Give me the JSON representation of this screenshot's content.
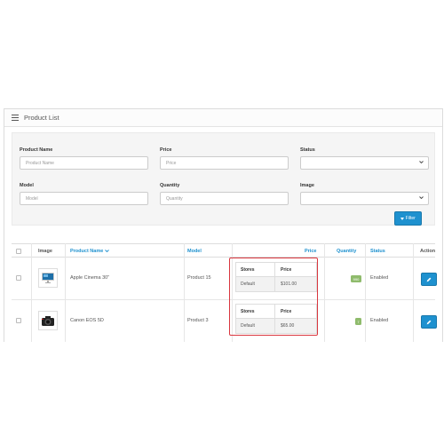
{
  "panel": {
    "title": "Product List",
    "title_icon": "list-icon"
  },
  "filter": {
    "product_name_label": "Product Name",
    "product_name_placeholder": "Product Name",
    "price_label": "Price",
    "price_placeholder": "Price",
    "status_label": "Status",
    "status_value": "",
    "model_label": "Model",
    "model_placeholder": "Model",
    "quantity_label": "Quantity",
    "quantity_placeholder": "Quantity",
    "image_label": "Image",
    "image_value": "",
    "filter_button": "Filter",
    "filter_icon": "funnel-icon"
  },
  "table": {
    "headers": {
      "image": "Image",
      "product_name": "Product Name",
      "model": "Model",
      "price": "Price",
      "quantity": "Quantity",
      "status": "Status",
      "action": "Action"
    },
    "sort_indicator": "chevron-down-icon",
    "store_header_stores": "Stores",
    "store_header_price": "Price",
    "rows": [
      {
        "image_icon": "monitor-icon",
        "product_name": "Apple Cinema 30\"",
        "model": "Product 15",
        "stores": [
          {
            "store": "Default",
            "price": "$101.00"
          }
        ],
        "quantity": "990",
        "status": "Enabled",
        "action_icon": "pencil-icon"
      },
      {
        "image_icon": "camera-icon",
        "product_name": "Canon EOS 5D",
        "model": "Product 3",
        "stores": [
          {
            "store": "Default",
            "price": "$65.00"
          }
        ],
        "quantity": "7",
        "status": "Enabled",
        "action_icon": "pencil-icon"
      }
    ]
  },
  "colors": {
    "accent": "#1e91cf",
    "quantity_badge": "#8fbb6c",
    "highlight": "#d9363e"
  }
}
